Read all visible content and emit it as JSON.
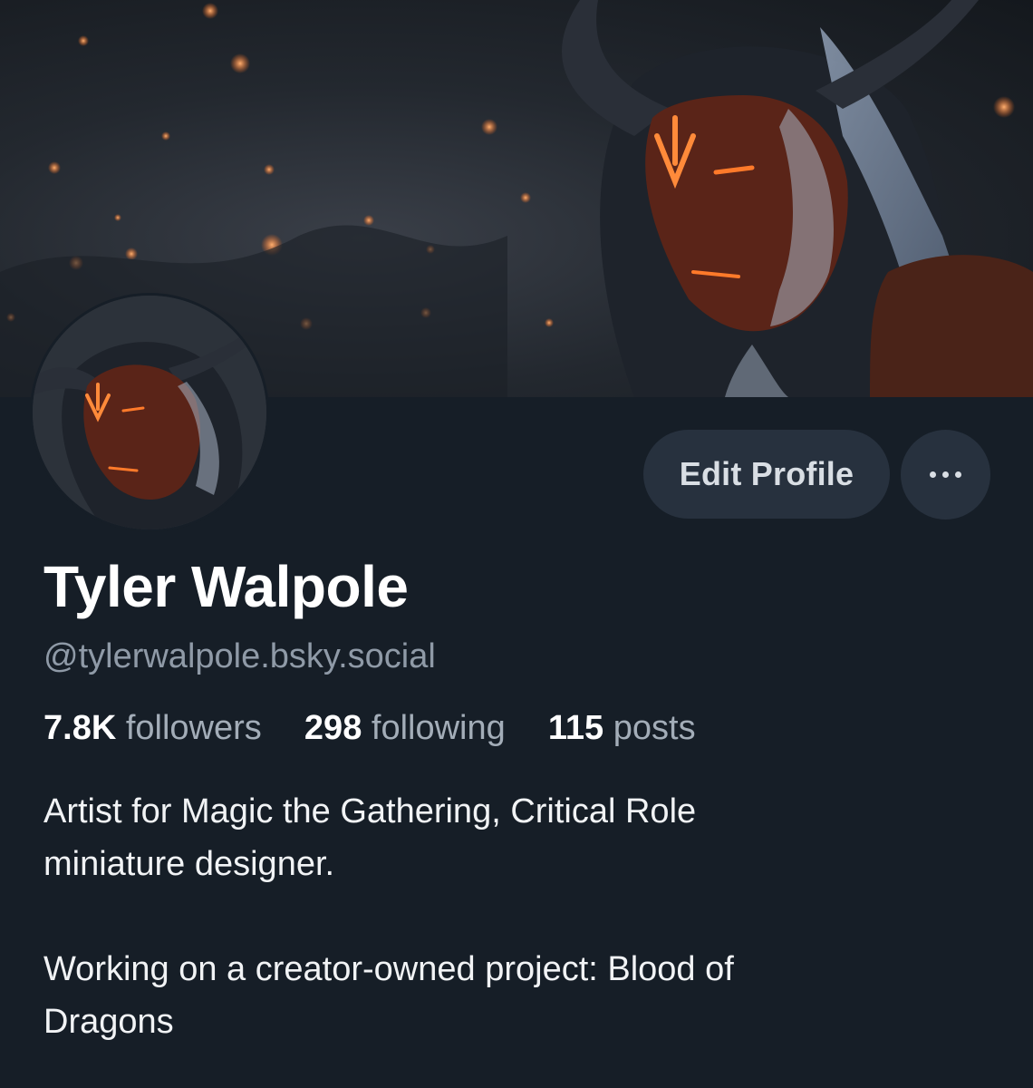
{
  "profile": {
    "display_name": "Tyler Walpole",
    "handle": "@tylerwalpole.bsky.social",
    "stats": {
      "followers_count": "7.8K",
      "followers_label": "followers",
      "following_count": "298",
      "following_label": "following",
      "posts_count": "115",
      "posts_label": "posts"
    },
    "bio_lines_1": [
      "Artist for Magic the Gathering, Critical Role",
      "miniature designer."
    ],
    "bio_lines_2": [
      "Working on a creator-owned project: Blood of",
      "Dragons"
    ]
  },
  "actions": {
    "edit_profile_label": "Edit Profile",
    "more_icon": "more-horizontal-icon"
  },
  "colors": {
    "background": "#161e27",
    "button_bg": "#27313e",
    "handle_text": "#8f9aa7",
    "accent_glow": "#ff7a2a"
  }
}
